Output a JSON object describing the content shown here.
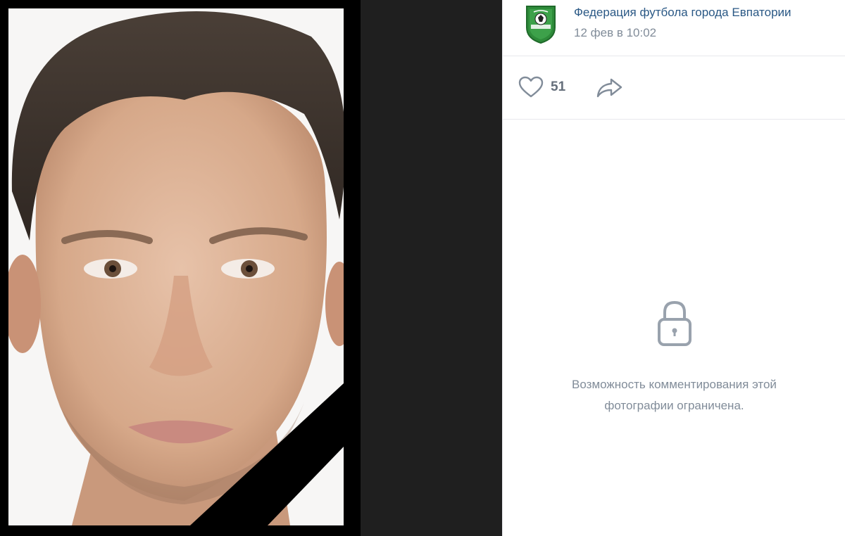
{
  "post": {
    "author": "Федерация футбола города Евпатории",
    "date": "12 фев в 10:02"
  },
  "actions": {
    "likes": "51"
  },
  "comments": {
    "restricted_text": "Возможность комментирования этой фотографии ограничена."
  },
  "icons": {
    "like": "heart-icon",
    "share": "share-arrow-icon",
    "lock": "lock-icon",
    "avatar": "football-federation-shield-logo"
  },
  "colors": {
    "link": "#2a5885",
    "muted": "#818c99",
    "viewer_bg": "#1f1f1f",
    "logo_green": "#2e8b3a"
  }
}
